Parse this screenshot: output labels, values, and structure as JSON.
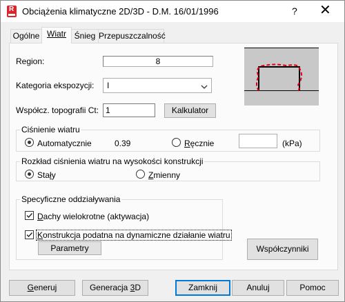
{
  "window": {
    "title": "Obciążenia klimatyczne 2D/3D - D.M. 16/01/1996",
    "help_glyph": "?",
    "close_glyph": "✕"
  },
  "tabs": [
    {
      "label": "Ogólne",
      "active": false
    },
    {
      "label": "Wiatr",
      "active": true
    },
    {
      "label": "Śnieg",
      "active": false
    },
    {
      "label": "Przepuszczalność",
      "active": false
    }
  ],
  "form": {
    "region_label": "Region:",
    "region_value": "8",
    "exposure_label": "Kategoria ekspozycji:",
    "exposure_value": "I",
    "topo_label": "Współcz. topografii Ct:",
    "topo_value": "1",
    "calculator_button": "Kalkulator"
  },
  "pressure_group": {
    "title": "Ciśnienie wiatru",
    "auto_label": "Automatycznie",
    "auto_value": "0.39",
    "manual_label": "Ręcznie",
    "manual_value": "",
    "unit": "(kPa)",
    "selected": "auto"
  },
  "distribution_group": {
    "title": "Rozkład ciśnienia wiatru na wysokości konstrukcji",
    "constant_label": "Stały",
    "variable_label": "Zmienny",
    "selected": "constant"
  },
  "specific_group": {
    "title": "Specyficzne oddziaływania",
    "multi_roof_label": "Dachy wielokrotne (aktywacja)",
    "multi_roof_checked": true,
    "dynamic_label": "Konstrukcja podatna na dynamiczne działanie wiatru",
    "dynamic_checked": true,
    "params_button": "Parametry"
  },
  "coefficients_button": "Współczynniki",
  "footer": {
    "generate": "Generuj",
    "generate3d": "Generacja 3D",
    "close": "Zamknij",
    "cancel": "Anuluj",
    "help": "Pomoc"
  },
  "colors": {
    "title_bg": "#ffffff",
    "panel_bg": "#fbfbfb",
    "dialog_bg": "#f0f0f0",
    "accent": "#0078d7",
    "app_icon": "#d7262e",
    "preview_bg": "#c8c8c8",
    "preview_curve": "#e0001b"
  }
}
